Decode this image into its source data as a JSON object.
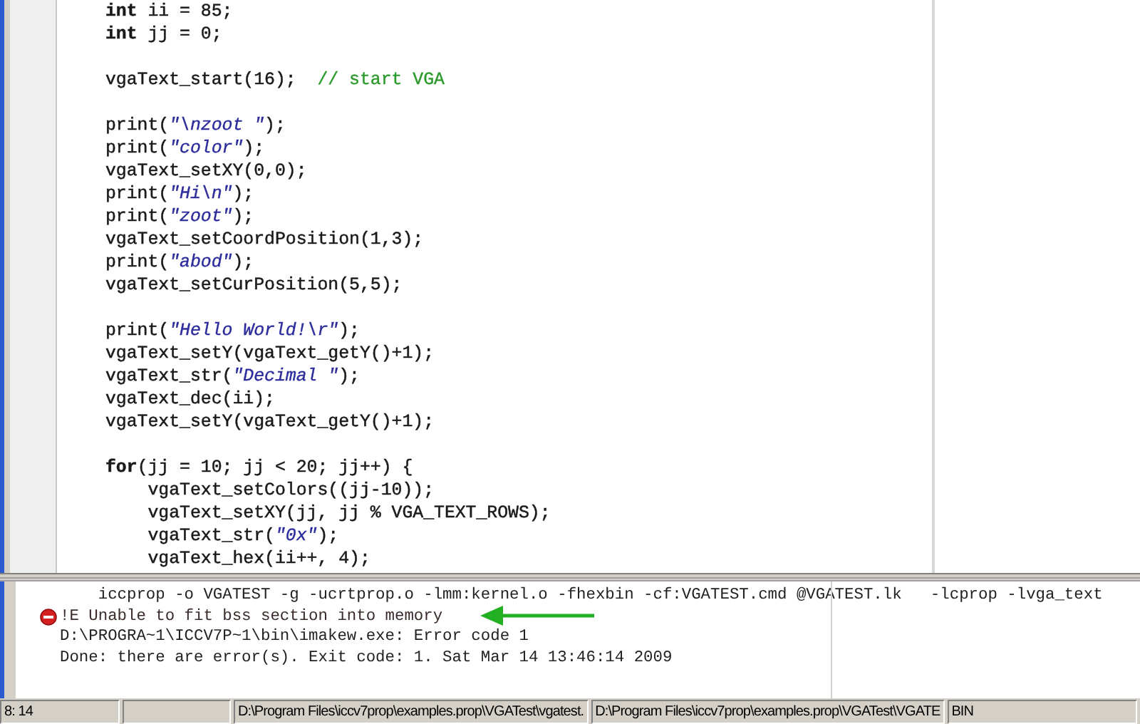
{
  "editor": {
    "blocks": [
      [
        [
          {
            "text": "int",
            "kind": "keyword"
          },
          {
            "text": " ii = 85;",
            "kind": "plain"
          }
        ],
        [
          {
            "text": "int",
            "kind": "keyword"
          },
          {
            "text": " jj = 0;",
            "kind": "plain"
          }
        ]
      ],
      [
        [
          {
            "text": "vgaText_start(16);  ",
            "kind": "plain"
          },
          {
            "text": "// start VGA",
            "kind": "comment"
          }
        ]
      ],
      [
        [
          {
            "text": "print(",
            "kind": "plain"
          },
          {
            "text": "\"\\nzoot \"",
            "kind": "string"
          },
          {
            "text": ");",
            "kind": "plain"
          }
        ],
        [
          {
            "text": "print(",
            "kind": "plain"
          },
          {
            "text": "\"color\"",
            "kind": "string"
          },
          {
            "text": ");",
            "kind": "plain"
          }
        ],
        [
          {
            "text": "vgaText_setXY(0,0);",
            "kind": "plain"
          }
        ],
        [
          {
            "text": "print(",
            "kind": "plain"
          },
          {
            "text": "\"Hi\\n\"",
            "kind": "string"
          },
          {
            "text": ");",
            "kind": "plain"
          }
        ],
        [
          {
            "text": "print(",
            "kind": "plain"
          },
          {
            "text": "\"zoot\"",
            "kind": "string"
          },
          {
            "text": ");",
            "kind": "plain"
          }
        ],
        [
          {
            "text": "vgaText_setCoordPosition(1,3);",
            "kind": "plain"
          }
        ],
        [
          {
            "text": "print(",
            "kind": "plain"
          },
          {
            "text": "\"abod\"",
            "kind": "string"
          },
          {
            "text": ");",
            "kind": "plain"
          }
        ],
        [
          {
            "text": "vgaText_setCurPosition(5,5);",
            "kind": "plain"
          }
        ]
      ],
      [
        [
          {
            "text": "print(",
            "kind": "plain"
          },
          {
            "text": "\"Hello World!\\r\"",
            "kind": "string"
          },
          {
            "text": ");",
            "kind": "plain"
          }
        ],
        [
          {
            "text": "vgaText_setY(vgaText_getY()+1);",
            "kind": "plain"
          }
        ],
        [
          {
            "text": "vgaText_str(",
            "kind": "plain"
          },
          {
            "text": "\"Decimal \"",
            "kind": "string"
          },
          {
            "text": ");",
            "kind": "plain"
          }
        ],
        [
          {
            "text": "vgaText_dec(ii);",
            "kind": "plain"
          }
        ],
        [
          {
            "text": "vgaText_setY(vgaText_getY()+1);",
            "kind": "plain"
          }
        ]
      ],
      [
        [
          {
            "text": "for",
            "kind": "keyword"
          },
          {
            "text": "(jj = 10; jj < 20; jj++) {",
            "kind": "plain"
          }
        ],
        [
          {
            "text": "    vgaText_setColors((jj-10));",
            "kind": "plain"
          }
        ],
        [
          {
            "text": "    vgaText_setXY(jj, jj % VGA_TEXT_ROWS);",
            "kind": "plain"
          }
        ],
        [
          {
            "text": "    vgaText_str(",
            "kind": "plain"
          },
          {
            "text": "\"0x\"",
            "kind": "string"
          },
          {
            "text": ");",
            "kind": "plain"
          }
        ],
        [
          {
            "text": "    vgaText_hex(ii++, 4);",
            "kind": "plain"
          }
        ]
      ]
    ]
  },
  "output": {
    "lines": [
      {
        "kind": "command",
        "text": "    iccprop -o VGATEST -g -ucrtprop.o -lmm:kernel.o -fhexbin -cf:VGATEST.cmd @VGATEST.lk   -lcprop -lvga_text"
      },
      {
        "kind": "error",
        "text": "!E Unable to fit bss section into memory"
      },
      {
        "kind": "info",
        "text": "D:\\PROGRA~1\\ICCV7P~1\\bin\\imakew.exe: Error code 1"
      },
      {
        "kind": "info",
        "text": "Done: there are error(s). Exit code: 1. Sat Mar 14 13:46:14 2009"
      }
    ]
  },
  "status_bar": {
    "position": "8: 14",
    "files": [
      "D:\\Program Files\\iccv7prop\\examples.prop\\VGATest\\vgatest.",
      "D:\\Program Files\\iccv7prop\\examples.prop\\VGATest\\VGATE"
    ],
    "mode": "BIN"
  }
}
